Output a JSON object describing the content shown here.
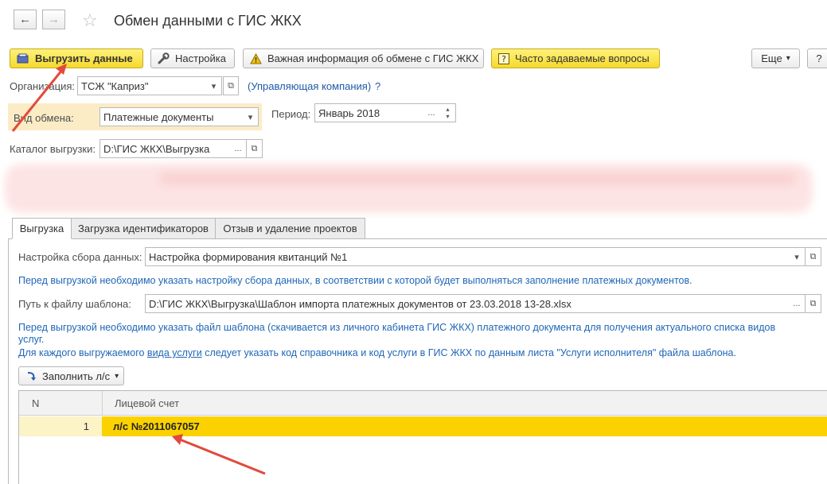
{
  "window": {
    "title": "Обмен данными с ГИС ЖКХ",
    "back_icon": "←",
    "forward_icon": "→",
    "favorite_icon": "☆"
  },
  "toolbar": {
    "export_label": "Выгрузить данные",
    "settings_label": "Настройка",
    "important_info_label": "Важная информация об обмене с ГИС ЖКХ",
    "faq_label": "Часто задаваемые вопросы",
    "more_label": "Еще",
    "help_label": "?"
  },
  "form": {
    "organization_label": "Организация:",
    "organization_value": "ТСЖ \"Каприз\"",
    "management_company_link": "(Управляющая компания)",
    "management_company_help": "?",
    "exchange_type_label": "Вид обмена:",
    "exchange_type_value": "Платежные документы",
    "period_label": "Период:",
    "period_value": "Январь 2018",
    "catalog_label": "Каталог выгрузки:",
    "catalog_value": "D:\\ГИС ЖКХ\\Выгрузка",
    "ellipsis": "...",
    "dropdown_arrow": "▾"
  },
  "tabs": [
    {
      "label": "Выгрузка"
    },
    {
      "label": "Загрузка идентификаторов"
    },
    {
      "label": "Отзыв и удаление проектов"
    }
  ],
  "export_tab": {
    "data_collection_label": "Настройка сбора данных:",
    "data_collection_value": "Настройка формирования квитанций №1",
    "info_data_collection": "Перед выгрузкой необходимо указать настройку сбора данных, в соответствии с которой будет выполняться заполнение платежных документов.",
    "template_path_label": "Путь к файлу шаблона:",
    "template_path_value": "D:\\ГИС ЖКХ\\Выгрузка\\Шаблон импорта платежных документов от 23.03.2018 13-28.xlsx",
    "info_template_line1": "Перед выгрузкой необходимо указать файл шаблона (скачивается из личного кабинета ГИС ЖКХ) платежного документа для получения актуального списка видов",
    "info_template_line2": "услуг.",
    "info_service_part1": "Для каждого выгружаемого ",
    "info_service_link": "вида услуги",
    "info_service_part2": " следует указать код справочника и код услуги в ГИС ЖКХ по данным листа \"Услуги исполнителя\" файла шаблона.",
    "fill_button_label": "Заполнить л/с"
  },
  "table": {
    "columns": [
      "N",
      "Лицевой счет"
    ],
    "rows": [
      {
        "n": "1",
        "account": "л/с №2011067057"
      }
    ]
  },
  "colors": {
    "accent_yellow": "#fbd200",
    "row_selected": "#fbd200",
    "row_n_cell": "#fcf3c7",
    "annotation_arrow": "#e24a3b",
    "link_blue": "#1f5aa6",
    "info_blue": "#2067b7"
  }
}
